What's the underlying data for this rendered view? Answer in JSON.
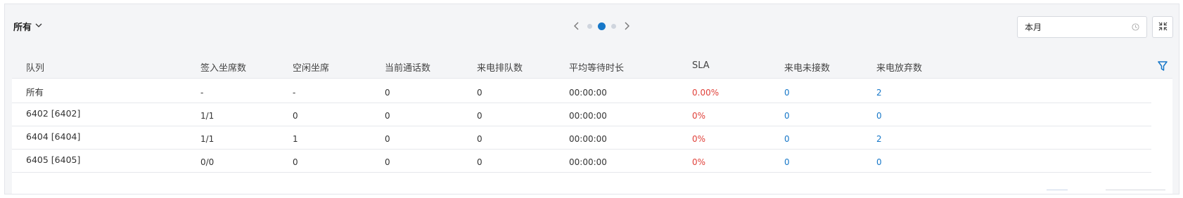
{
  "toolbar": {
    "filter_label": "所有",
    "date_value": "本月"
  },
  "icons": {
    "filter_dropdown": "chevron-down-icon",
    "prev": "chevron-left-icon",
    "next": "chevron-right-icon",
    "clock": "clock-icon",
    "fullscreen": "fullscreen-icon",
    "column_filter": "funnel-filter-icon"
  },
  "pager": {
    "pages": 3,
    "active": 2
  },
  "colors": {
    "accent": "#1677c8",
    "danger": "#e0413a"
  },
  "table": {
    "headers": [
      "队列",
      "签入坐席数",
      "空闲坐席",
      "当前通话数",
      "来电排队数",
      "平均等待时长",
      "SLA",
      "来电未接数",
      "来电放弃数"
    ],
    "rows": [
      [
        "所有",
        "-",
        "-",
        "0",
        "0",
        "00:00:00",
        "0.00%",
        "0",
        "2"
      ],
      [
        "6402 [6402]",
        "1/1",
        "0",
        "0",
        "0",
        "00:00:00",
        "0%",
        "0",
        "0"
      ],
      [
        "6404 [6404]",
        "1/1",
        "1",
        "0",
        "0",
        "00:00:00",
        "0%",
        "0",
        "2"
      ],
      [
        "6405 [6405]",
        "0/0",
        "0",
        "0",
        "0",
        "00:00:00",
        "0%",
        "0",
        "0"
      ]
    ]
  }
}
